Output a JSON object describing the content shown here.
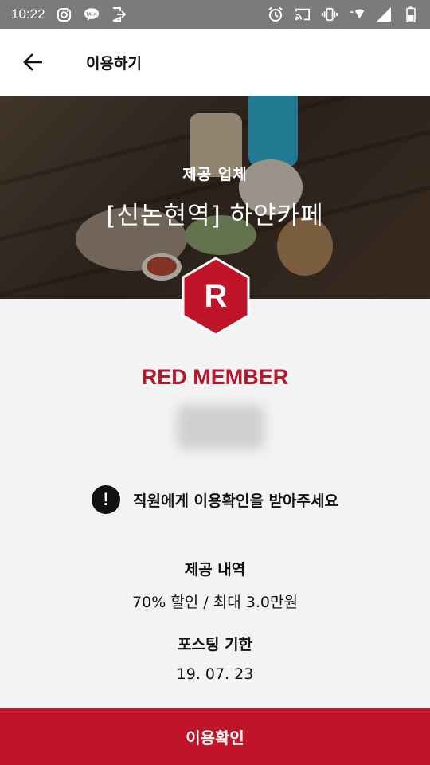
{
  "status_bar": {
    "time": "10:22",
    "left_icons": [
      "instagram-icon",
      "kakaotalk-icon",
      "exit-icon"
    ],
    "right_icons": [
      "alarm-icon",
      "cast-icon",
      "vibrate-icon",
      "wifi-icon",
      "signal-icon",
      "battery-icon"
    ]
  },
  "app_bar": {
    "title": "이용하기",
    "back_icon": "arrow-left-icon"
  },
  "hero": {
    "caption": "제공 업체",
    "store_name": "[신논현역] 하얀카페"
  },
  "badge": {
    "letter": "R",
    "color": "#c01428"
  },
  "member": {
    "level": "RED MEMBER"
  },
  "notice": {
    "icon": "exclamation-icon",
    "text": "직원에게 이용확인을 받아주세요"
  },
  "offer": {
    "label": "제공 내역",
    "value": "70% 할인 / 최대 3.0만원"
  },
  "deadline": {
    "label": "포스팅 기한",
    "value": "19. 07. 23"
  },
  "confirm_button": {
    "label": "이용확인",
    "color": "#c01428"
  }
}
